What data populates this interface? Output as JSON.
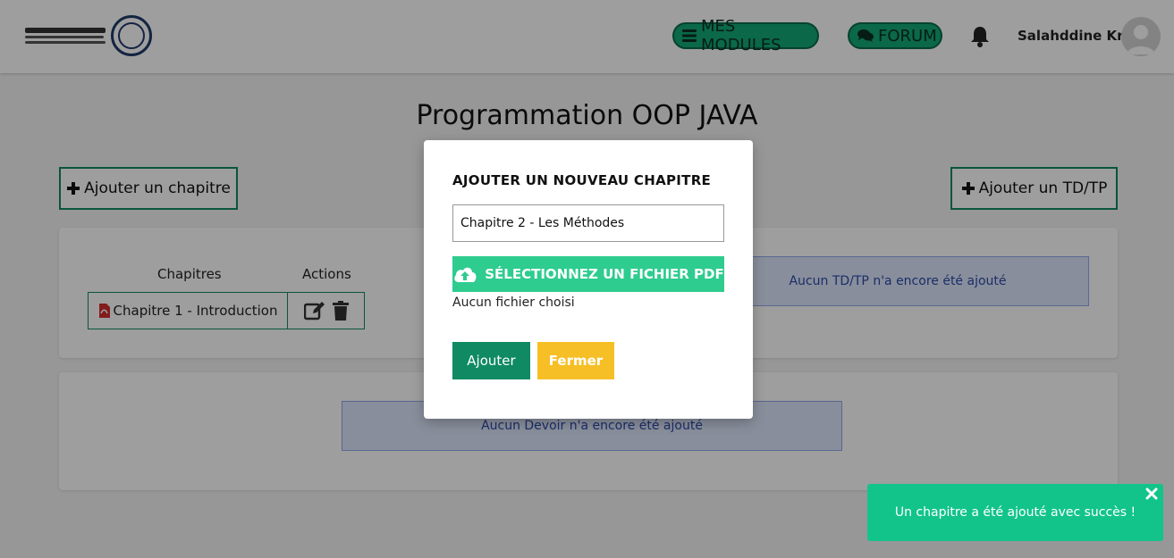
{
  "header": {
    "nav_modules": "MES MODULES",
    "nav_forum": "FORUM",
    "user_name": "Salahddine Krit"
  },
  "main": {
    "title": "Programmation OOP JAVA",
    "add_chapter": "Ajouter un chapitre",
    "add_td": "Ajouter un TD/TP",
    "table": {
      "col_chapters": "Chapitres",
      "col_actions": "Actions",
      "rows": [
        {
          "chapter": "Chapitre 1 - Introduction"
        }
      ]
    },
    "td_empty": "Aucun TD/TP n'a encore été ajouté",
    "devoir_empty": "Aucun Devoir n'a encore été ajouté"
  },
  "modal": {
    "title": "AJOUTER UN NOUVEAU CHAPITRE",
    "input_value": "Chapitre 2 - Les Méthodes",
    "file_button": "SÉLECTIONNEZ UN FICHIER PDF",
    "file_status": "Aucun fichier choisi",
    "submit": "Ajouter",
    "close": "Fermer"
  },
  "toast": {
    "message": "Un chapitre a été ajouté avec succès !"
  },
  "colors": {
    "primary": "#0f8a63",
    "nav_green": "#12a877",
    "file_green": "#2ecc8f",
    "warning": "#f7bf26",
    "toast": "#12c489",
    "info_bg": "#dbe6fb"
  },
  "icons": [
    "menu-icon",
    "comments-icon",
    "bell-icon",
    "plus-icon",
    "pdf-icon",
    "edit-icon",
    "trash-icon",
    "cloud-upload-icon",
    "close-icon"
  ]
}
